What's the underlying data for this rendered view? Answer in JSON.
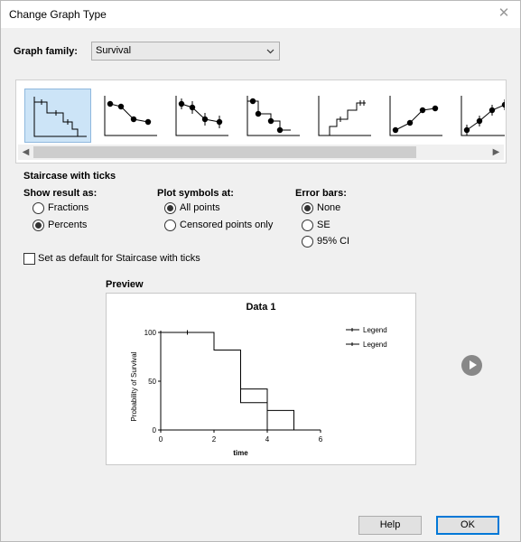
{
  "window": {
    "title": "Change Graph Type",
    "close_glyph": "✕"
  },
  "graph_family": {
    "label": "Graph family:",
    "value": "Survival"
  },
  "section_title": "Staircase with ticks",
  "thumbnails": [
    {
      "name": "staircase-with-ticks",
      "selected": true
    },
    {
      "name": "points-connected",
      "selected": false
    },
    {
      "name": "points-with-error-bars",
      "selected": false
    },
    {
      "name": "staircase-with-points",
      "selected": false
    },
    {
      "name": "staircase-rising-with-ticks",
      "selected": false
    },
    {
      "name": "points-rising",
      "selected": false
    },
    {
      "name": "points-rising-with-error-bars",
      "selected": false
    }
  ],
  "show_result": {
    "label": "Show result as:",
    "options": [
      {
        "label": "Fractions",
        "checked": false
      },
      {
        "label": "Percents",
        "checked": true
      }
    ]
  },
  "plot_symbols": {
    "label": "Plot symbols at:",
    "options": [
      {
        "label": "All points",
        "checked": true
      },
      {
        "label": "Censored points only",
        "checked": false
      }
    ]
  },
  "error_bars": {
    "label": "Error bars:",
    "options": [
      {
        "label": "None",
        "checked": true
      },
      {
        "label": "SE",
        "checked": false
      },
      {
        "label": "95% CI",
        "checked": false
      }
    ]
  },
  "default_checkbox": {
    "label": "Set as default for Staircase with ticks",
    "checked": false
  },
  "preview": {
    "label": "Preview",
    "chart_data": {
      "type": "line",
      "title": "Data 1",
      "xlabel": "time",
      "ylabel": "Probability of Survival",
      "xlim": [
        0,
        6
      ],
      "ylim": [
        0,
        100
      ],
      "xticks": [
        "0",
        "2",
        "4",
        "6"
      ],
      "yticks": [
        "0",
        "50",
        "100"
      ],
      "series": [
        {
          "name": "Legend",
          "steps": [
            [
              0,
              100
            ],
            [
              2,
              100
            ],
            [
              2,
              82
            ],
            [
              3,
              82
            ],
            [
              3,
              28
            ],
            [
              4,
              28
            ],
            [
              4,
              0
            ]
          ],
          "ticks": [
            [
              1,
              100
            ]
          ]
        },
        {
          "name": "Legend",
          "steps": [
            [
              0,
              100
            ],
            [
              2,
              100
            ],
            [
              2,
              82
            ],
            [
              3,
              82
            ],
            [
              3,
              42
            ],
            [
              4,
              42
            ],
            [
              4,
              20
            ],
            [
              5,
              20
            ],
            [
              5,
              0
            ]
          ],
          "ticks": []
        }
      ],
      "legend_position": "top-right"
    }
  },
  "buttons": {
    "help": "Help",
    "ok": "OK"
  }
}
